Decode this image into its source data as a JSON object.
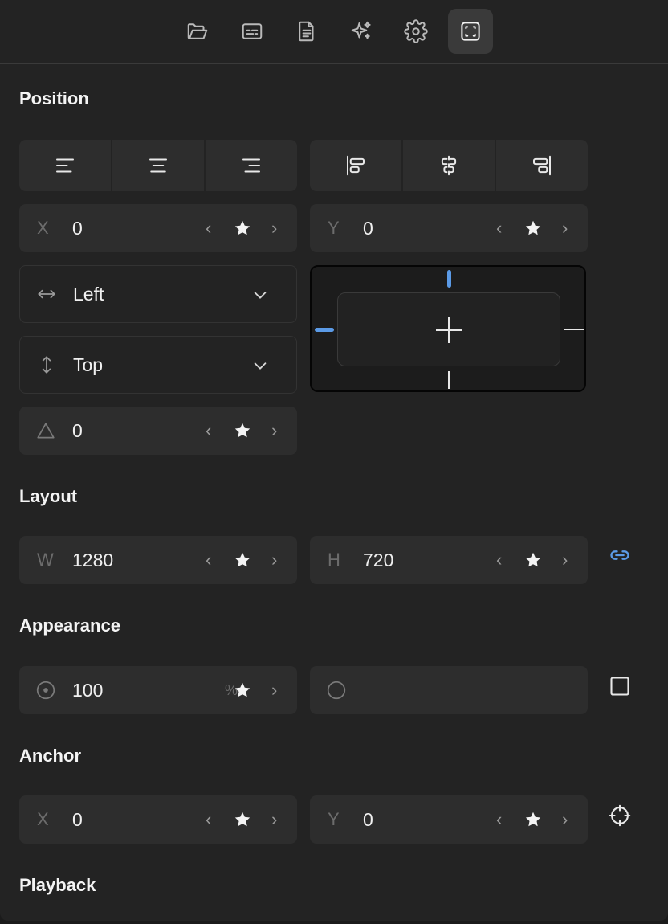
{
  "toolbar": {
    "icons": [
      "folder-open-icon",
      "caption-icon",
      "document-icon",
      "sparkles-icon",
      "settings-icon",
      "frame-icon"
    ],
    "active": "frame-icon"
  },
  "sections": {
    "position": "Position",
    "layout": "Layout",
    "appearance": "Appearance",
    "anchor": "Anchor",
    "playback": "Playback"
  },
  "position": {
    "x": {
      "label": "X",
      "value": "0"
    },
    "y": {
      "label": "Y",
      "value": "0"
    },
    "horizontal": "Left",
    "vertical": "Top",
    "rotation": {
      "value": "0"
    }
  },
  "layout": {
    "w": {
      "label": "W",
      "value": "1280"
    },
    "h": {
      "label": "H",
      "value": "720"
    }
  },
  "appearance": {
    "opacity": {
      "value": "100",
      "unit": "%"
    }
  },
  "anchor": {
    "x": {
      "label": "X",
      "value": "0"
    },
    "y": {
      "label": "Y",
      "value": "0"
    }
  },
  "glyphs": {
    "prev": "‹",
    "next": "›"
  },
  "colors": {
    "accent": "#5b9ae6",
    "panel": "#232323",
    "field": "#2d2d2d"
  }
}
